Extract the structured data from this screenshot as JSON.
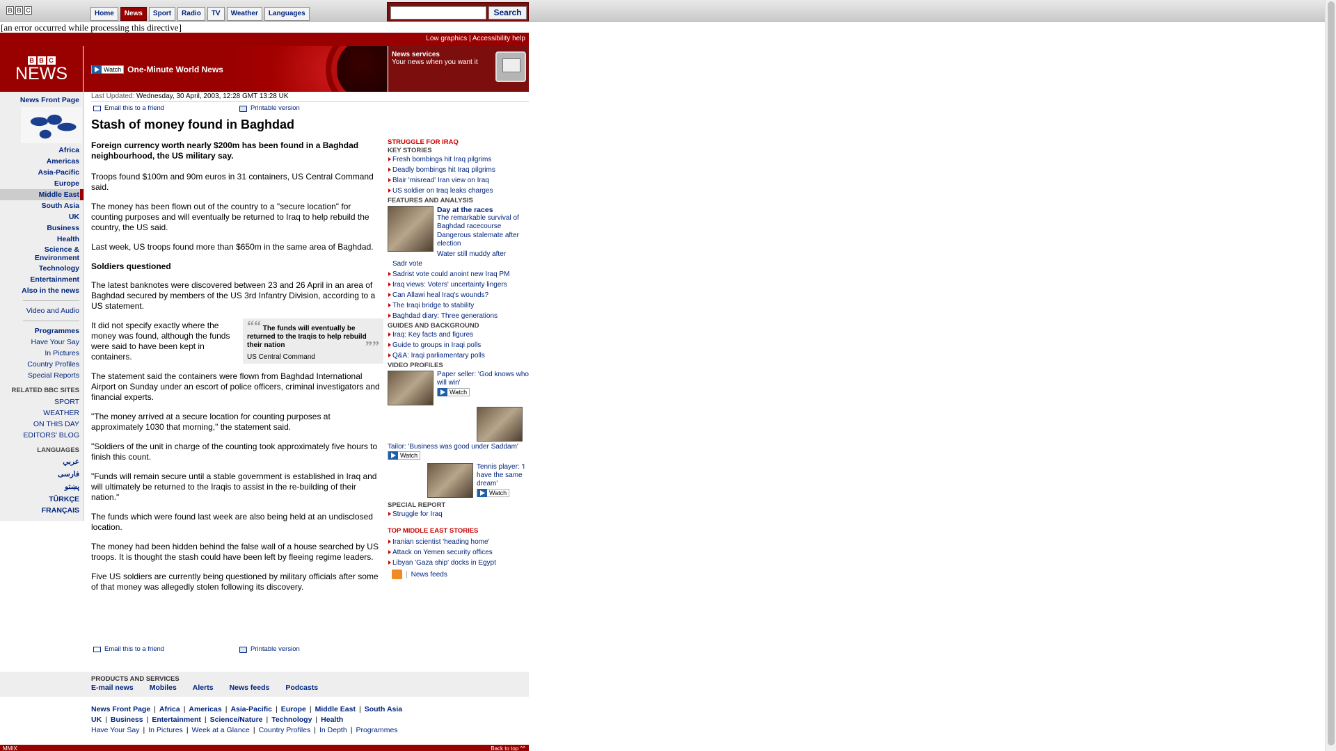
{
  "topbar": {
    "logo": [
      "B",
      "B",
      "C"
    ],
    "tabs": [
      "Home",
      "News",
      "Sport",
      "Radio",
      "TV",
      "Weather",
      "Languages"
    ],
    "active_tab": "News",
    "search_value": "",
    "search_button": "Search"
  },
  "error_text": "[an error occurred while processing this directive]",
  "utility": {
    "low_graphics": "Low graphics",
    "separator": "|",
    "accessibility": "Accessibility help"
  },
  "banner": {
    "logo_letters": [
      "B",
      "B",
      "C"
    ],
    "logo_word": "NEWS",
    "watch_label": "Watch",
    "watch_title": "One-Minute World News",
    "services_title": "News services",
    "services_sub": "Your news when you want it"
  },
  "leftnav": {
    "front_page": "News Front Page",
    "regions": [
      "Africa",
      "Americas",
      "Asia-Pacific",
      "Europe",
      "Middle East",
      "South Asia",
      "UK",
      "Business",
      "Health",
      "Science & Environment",
      "Technology",
      "Entertainment",
      "Also in the news"
    ],
    "selected": "Middle East",
    "video_audio": "Video and Audio",
    "extras": [
      "Programmes",
      "Have Your Say",
      "In Pictures",
      "Country Profiles",
      "Special Reports"
    ],
    "related_heading": "RELATED BBC SITES",
    "related": [
      "SPORT",
      "WEATHER",
      "ON THIS DAY",
      "EDITORS' BLOG"
    ],
    "languages_heading": "LANGUAGES",
    "languages": [
      "عربي",
      "فارسی",
      "پښتو",
      "TÜRKÇE",
      "FRANÇAIS"
    ]
  },
  "article": {
    "updated_label": "Last Updated:",
    "updated_value": "Wednesday, 30 April, 2003, 12:28 GMT 13:28 UK",
    "email_link": "Email this to a friend",
    "print_link": "Printable version",
    "headline": "Stash of money found in Baghdad",
    "intro": "Foreign currency worth nearly $200m has been found in a Baghdad neighbourhood, the US military say.",
    "p1": "Troops found $100m and 90m euros in 31 containers, US Central Command said.",
    "p2": "The money has been flown out of the country to a \"secure location\" for counting purposes and will eventually be returned to Iraq to help rebuild the country, the US said.",
    "p3": "Last week, US troops found more than $650m in the same area of Baghdad.",
    "crosshead": "Soldiers questioned",
    "p4": "The latest banknotes were discovered between 23 and 26 April in an area of Baghdad secured by members of the US 3rd Infantry Division, according to a US statement.",
    "p5": "It did not specify exactly where the money was found, although the funds were said to have been kept in containers.",
    "quote_text": "The funds will eventually be returned to the Iraqis to help rebuild their nation",
    "quote_source": "US Central Command",
    "p6": "The statement said the containers were flown from Baghdad International Airport on Sunday under an escort of police officers, criminal investigators and financial experts.",
    "p7": "\"The money arrived at a secure location for counting purposes at approximately 1030 that morning,\" the statement said.",
    "p8": "\"Soldiers of the unit in charge of the counting took approximately five hours to finish this count.",
    "p9": "\"Funds will remain secure until a stable government is established in Iraq and will ultimately be returned to the Iraqis to assist in the re-building of their nation.\"",
    "p10": "The funds which were found last week are also being held at an undisclosed location.",
    "p11": "The money had been hidden behind the false wall of a house searched by US troops. It is thought the stash could have been left by fleeing regime leaders.",
    "p12": "Five US soldiers are currently being questioned by military officials after some of that money was allegedly stolen following its discovery."
  },
  "rightcol": {
    "struggle_heading": "STRUGGLE FOR IRAQ",
    "key_stories_heading": "KEY STORIES",
    "key_stories": [
      "Fresh bombings hit Iraq pilgrims",
      "Deadly bombings hit Iraq pilgrims",
      "Blair 'misread' Iran view on Iraq",
      "US soldier on Iraq leaks charges"
    ],
    "features_heading": "FEATURES AND ANALYSIS",
    "feature_title": "Day at the races",
    "feature_links": [
      "The remarkable survival of Baghdad racecourse",
      "Dangerous stalemate after election",
      "Water still muddy after"
    ],
    "feature_cont": "Sadr vote",
    "features": [
      "Sadrist vote could anoint new Iraq PM",
      "Iraq views: Voters' uncertainty lingers",
      "Can Allawi heal Iraq's wounds?",
      "The Iraqi bridge to stability",
      "Baghdad diary: Three generations"
    ],
    "guides_heading": "GUIDES AND BACKGROUND",
    "guides": [
      "Iraq: Key facts and figures",
      "Guide to groups in Iraqi polls",
      "Q&A: Iraqi parliamentary polls"
    ],
    "video_heading": "VIDEO PROFILES",
    "video1": "Paper seller: 'God knows who will win'",
    "video2": "Tailor: 'Business was good under Saddam'",
    "video3": "Tennis player: 'I have the same dream'",
    "watch": "Watch",
    "special_heading": "SPECIAL REPORT",
    "special_link": "Struggle for Iraq",
    "top_heading": "TOP MIDDLE EAST STORIES",
    "top_stories": [
      "Iranian scientist 'heading home'",
      "Attack on Yemen security offices",
      "Libyan 'Gaza ship' docks in Egypt"
    ],
    "feeds_sep": "|",
    "feeds_link": "News feeds"
  },
  "footer": {
    "products_heading": "PRODUCTS AND SERVICES",
    "products": [
      "E-mail news",
      "Mobiles",
      "Alerts",
      "News feeds",
      "Podcasts"
    ],
    "row1": [
      "News Front Page",
      "Africa",
      "Americas",
      "Asia-Pacific",
      "Europe",
      "Middle East",
      "South Asia"
    ],
    "row2": [
      "UK",
      "Business",
      "Entertainment",
      "Science/Nature",
      "Technology",
      "Health"
    ],
    "row3": [
      "Have Your Say",
      "In Pictures",
      "Week at a Glance",
      "Country Profiles",
      "In Depth",
      "Programmes"
    ],
    "sep": "|",
    "copyright": "MMIX",
    "back_to_top": "Back to top ^^"
  }
}
